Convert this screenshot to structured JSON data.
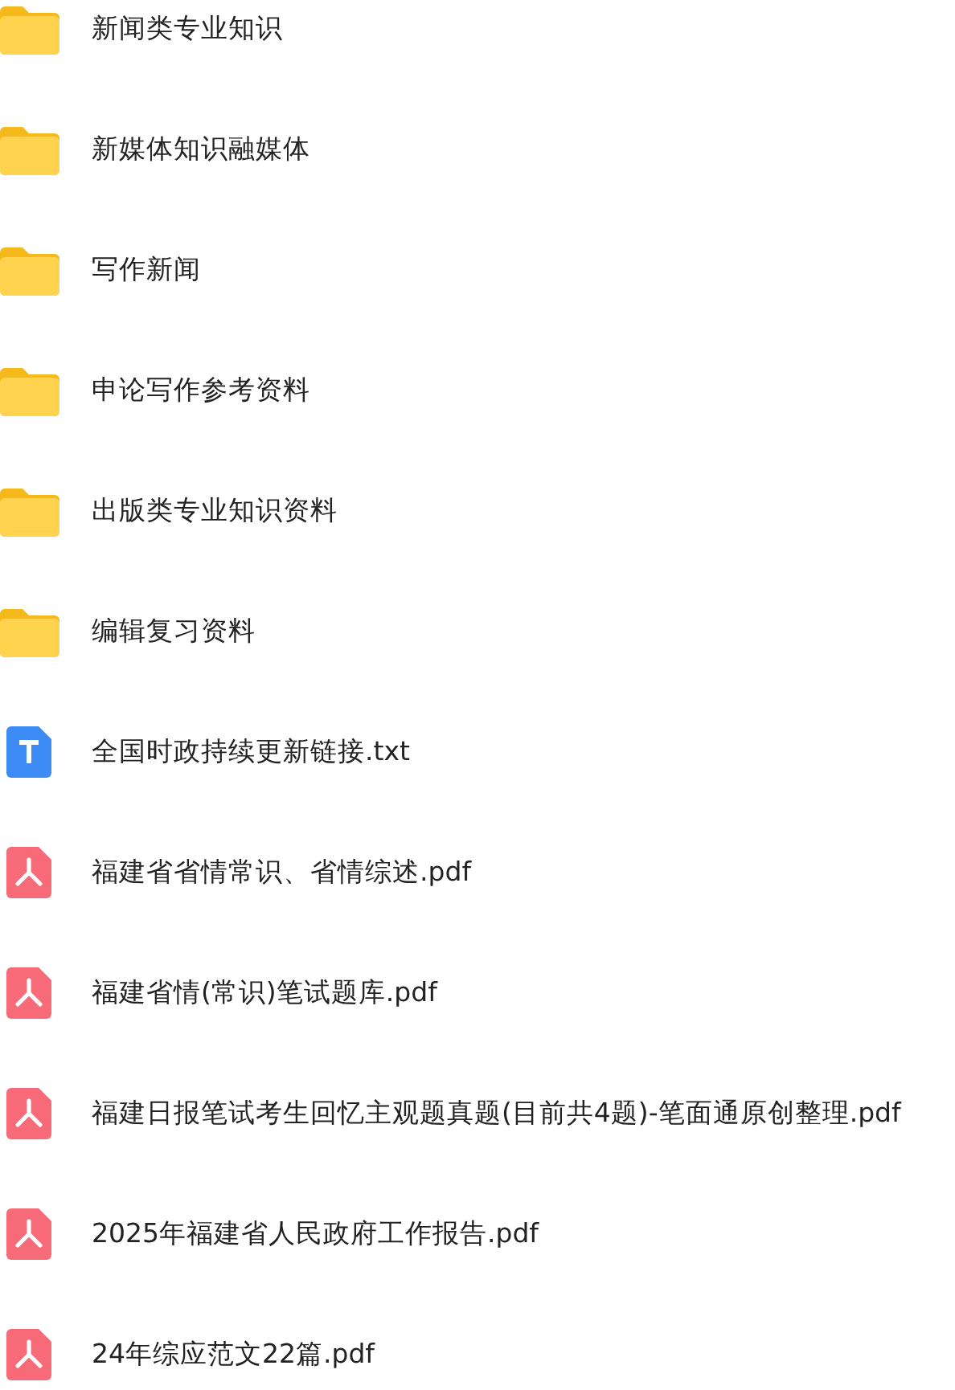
{
  "files": [
    {
      "kind": "folder",
      "name": "新闻类专业知识"
    },
    {
      "kind": "folder",
      "name": "新媒体知识融媒体"
    },
    {
      "kind": "folder",
      "name": "写作新闻"
    },
    {
      "kind": "folder",
      "name": "申论写作参考资料"
    },
    {
      "kind": "folder",
      "name": "出版类专业知识资料"
    },
    {
      "kind": "folder",
      "name": "编辑复习资料"
    },
    {
      "kind": "txt",
      "name": "全国时政持续更新链接.txt"
    },
    {
      "kind": "pdf",
      "name": "福建省省情常识、省情综述.pdf"
    },
    {
      "kind": "pdf",
      "name": "福建省情(常识)笔试题库.pdf"
    },
    {
      "kind": "pdf",
      "name": "福建日报笔试考生回忆主观题真题(目前共4题)-笔面通原创整理.pdf"
    },
    {
      "kind": "pdf",
      "name": "2025年福建省人民政府工作报告.pdf"
    },
    {
      "kind": "pdf",
      "name": "24年综应范文22篇.pdf"
    }
  ]
}
